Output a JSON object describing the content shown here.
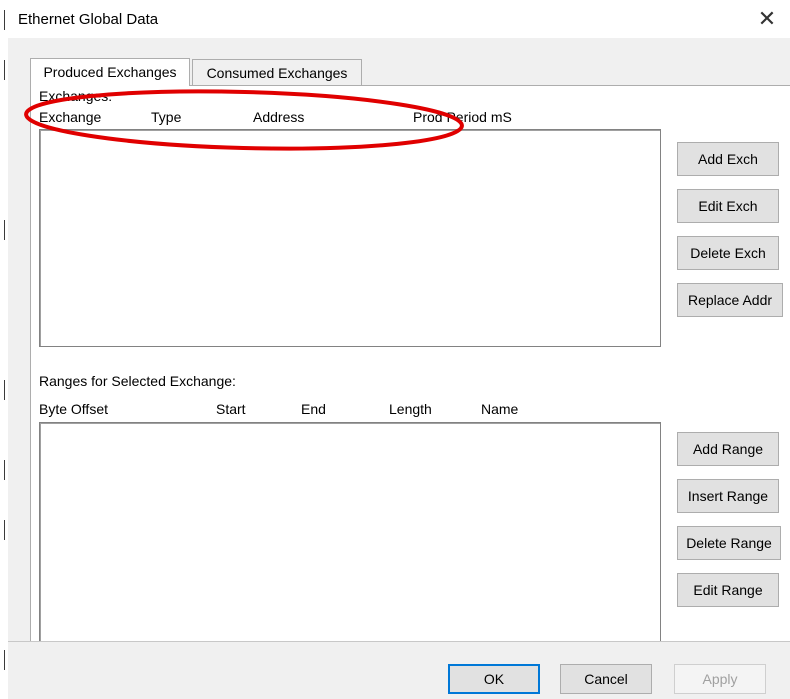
{
  "window": {
    "title": "Ethernet Global Data",
    "close_glyph": "✕"
  },
  "tabs": [
    {
      "label": "Produced Exchanges",
      "active": true
    },
    {
      "label": "Consumed Exchanges",
      "active": false
    }
  ],
  "exchanges": {
    "section_label": "Exchanges:",
    "columns": [
      "Exchange",
      "Type",
      "Address",
      "Prod Period mS"
    ],
    "rows": [],
    "buttons": [
      "Add Exch",
      "Edit Exch",
      "Delete Exch",
      "Replace Addr"
    ]
  },
  "ranges": {
    "section_label": "Ranges for Selected Exchange:",
    "columns": [
      "Byte Offset",
      "Start",
      "End",
      "Length",
      "Name"
    ],
    "rows": [],
    "buttons": [
      "Add Range",
      "Insert Range",
      "Delete Range",
      "Edit Range"
    ]
  },
  "dialog_buttons": {
    "ok": "OK",
    "cancel": "Cancel",
    "apply": "Apply"
  },
  "colors": {
    "annotation": "#e00000",
    "dialog_bg": "#f0f0f0",
    "focus_border": "#0078d7"
  }
}
